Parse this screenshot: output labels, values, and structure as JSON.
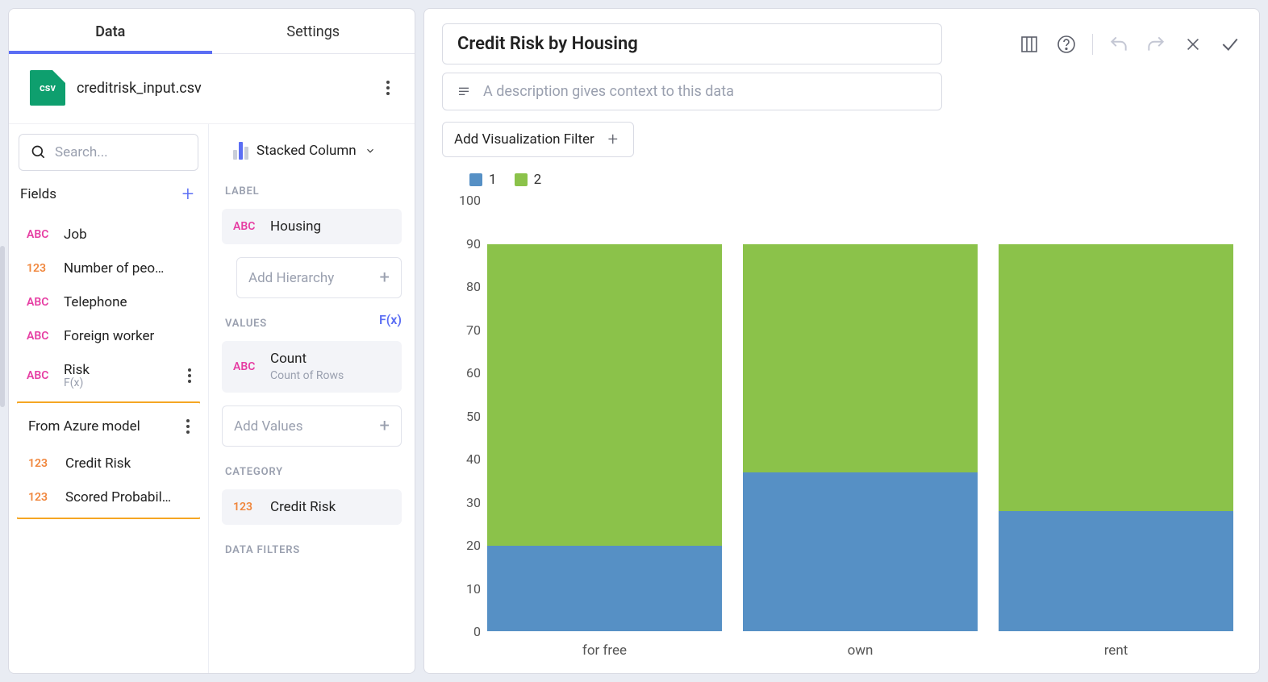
{
  "tabs": {
    "data": "Data",
    "settings": "Settings"
  },
  "file": {
    "badge": "csv",
    "name": "creditrisk_input.csv"
  },
  "search": {
    "placeholder": "Search..."
  },
  "fields_header": "Fields",
  "fields": [
    {
      "type": "ABC",
      "label": "Job"
    },
    {
      "type": "123",
      "label": "Number of peo…"
    },
    {
      "type": "ABC",
      "label": "Telephone"
    },
    {
      "type": "ABC",
      "label": "Foreign worker"
    },
    {
      "type": "ABC",
      "label": "Risk",
      "sub": "F(x)"
    }
  ],
  "group_title": "From Azure model",
  "group_fields": [
    {
      "type": "123",
      "label": "Credit Risk"
    },
    {
      "type": "123",
      "label": "Scored Probabil…"
    }
  ],
  "chart_type": "Stacked Column",
  "sections": {
    "label": "LABEL",
    "values": "VALUES",
    "category": "CATEGORY",
    "data_filters": "DATA FILTERS"
  },
  "label_chip": {
    "type": "ABC",
    "name": "Housing"
  },
  "add_hierarchy": "Add Hierarchy",
  "fx": "F(x)",
  "value_chip": {
    "type": "ABC",
    "name": "Count",
    "sub": "Count of Rows"
  },
  "add_values": "Add Values",
  "category_chip": {
    "type": "123",
    "name": "Credit Risk"
  },
  "title": "Credit Risk by Housing",
  "description_placeholder": "A description gives context to this data",
  "filter_label": "Add Visualization Filter",
  "legend": {
    "s1": "1",
    "s2": "2"
  },
  "colors": {
    "s1": "#5690c5",
    "s2": "#8bc24a"
  },
  "chart_data": {
    "type": "bar",
    "stacked": true,
    "categories": [
      "for free",
      "own",
      "rent"
    ],
    "series": [
      {
        "name": "1",
        "values": [
          22,
          41,
          31
        ]
      },
      {
        "name": "2",
        "values": [
          78,
          59,
          69
        ]
      }
    ],
    "ylim": [
      0,
      100
    ],
    "yticks": [
      0,
      10,
      20,
      30,
      40,
      50,
      60,
      70,
      80,
      90,
      100
    ],
    "title": "Credit Risk by Housing",
    "xlabel": "",
    "ylabel": ""
  }
}
